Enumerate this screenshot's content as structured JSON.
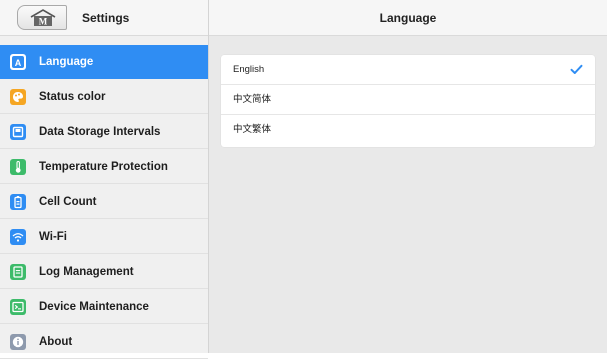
{
  "left_panel": {
    "title": "Settings",
    "home_icon": "home-m-icon",
    "items": [
      {
        "label": "Language",
        "icon": "language-icon",
        "icon_color": "#2f8df3",
        "active": true
      },
      {
        "label": "Status color",
        "icon": "palette-icon",
        "icon_color": "#f5a623",
        "active": false
      },
      {
        "label": "Data Storage Intervals",
        "icon": "storage-icon",
        "icon_color": "#2f8df3",
        "active": false
      },
      {
        "label": "Temperature Protection",
        "icon": "thermometer-icon",
        "icon_color": "#3dbb6a",
        "active": false
      },
      {
        "label": "Cell Count",
        "icon": "battery-icon",
        "icon_color": "#2f8df3",
        "active": false
      },
      {
        "label": "Wi-Fi",
        "icon": "wifi-icon",
        "icon_color": "#2f8df3",
        "active": false
      },
      {
        "label": "Log Management",
        "icon": "log-icon",
        "icon_color": "#3dbb6a",
        "active": false
      },
      {
        "label": "Device Maintenance",
        "icon": "terminal-icon",
        "icon_color": "#3dbb6a",
        "active": false
      },
      {
        "label": "About",
        "icon": "info-icon",
        "icon_color": "#8e9aad",
        "active": false
      }
    ]
  },
  "right_panel": {
    "title": "Language",
    "options": [
      {
        "label": "English",
        "selected": true
      },
      {
        "label": "中文简体",
        "selected": false
      },
      {
        "label": "中文繁体",
        "selected": false
      }
    ],
    "check_icon": "checkmark-icon",
    "accent_color": "#2f8df3"
  }
}
